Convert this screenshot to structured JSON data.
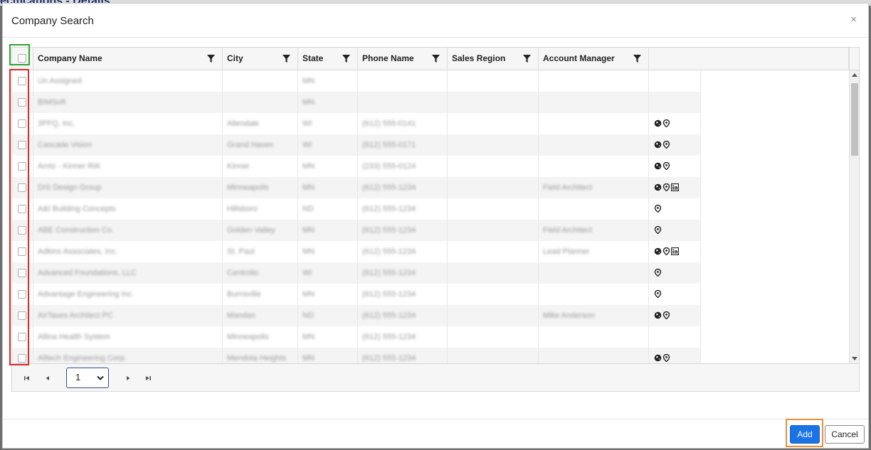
{
  "background": {
    "title": "ecifications - Details"
  },
  "modal": {
    "title": "Company Search",
    "close_symbol": "×"
  },
  "grid": {
    "columns": [
      "Company Name",
      "City",
      "State",
      "Phone Name",
      "Sales Region",
      "Account Manager"
    ],
    "rows": [
      {
        "company": "Un Assigned",
        "city": "",
        "state": "MN",
        "phone": "",
        "region": "",
        "manager": "",
        "icons": []
      },
      {
        "company": "BIMSoft",
        "city": "",
        "state": "MN",
        "phone": "",
        "region": "",
        "manager": "",
        "icons": []
      },
      {
        "company": "3PFQ, Inc.",
        "city": "Allendale",
        "state": "WI",
        "phone": "(612) 555-0141",
        "region": "",
        "manager": "",
        "icons": [
          "globe",
          "pin"
        ]
      },
      {
        "company": "Cascade Vision",
        "city": "Grand Haven",
        "state": "WI",
        "phone": "(612) 555-0171",
        "region": "",
        "manager": "",
        "icons": [
          "globe",
          "pin"
        ]
      },
      {
        "company": "Arntz - Kinner RIK",
        "city": "Kinner",
        "state": "MN",
        "phone": "(233) 555-0124",
        "region": "",
        "manager": "",
        "icons": [
          "globe",
          "pin"
        ]
      },
      {
        "company": "DIS Design Group",
        "city": "Minneapolis",
        "state": "MN",
        "phone": "(612) 555-1234",
        "region": "",
        "manager": "Field Architect",
        "icons": [
          "globe",
          "pin",
          "linkedin"
        ]
      },
      {
        "company": "A&I Building Concepts",
        "city": "Hillsboro",
        "state": "ND",
        "phone": "(612) 555-1234",
        "region": "",
        "manager": "",
        "icons": [
          "pin"
        ]
      },
      {
        "company": "ABE Construction Co.",
        "city": "Golden Valley",
        "state": "MN",
        "phone": "(612) 555-1234",
        "region": "",
        "manager": "Field Architect",
        "icons": [
          "pin"
        ]
      },
      {
        "company": "Adkins Associates, Inc.",
        "city": "St. Paul",
        "state": "MN",
        "phone": "(612) 555-1234",
        "region": "",
        "manager": "Lead Planner",
        "icons": [
          "globe",
          "pin",
          "linkedin"
        ]
      },
      {
        "company": "Advanced Foundations, LLC",
        "city": "Centrolio",
        "state": "WI",
        "phone": "(612) 555-1234",
        "region": "",
        "manager": "",
        "icons": [
          "pin"
        ]
      },
      {
        "company": "Advantage Engineering Inc.",
        "city": "Burnsville",
        "state": "MN",
        "phone": "(612) 555-1234",
        "region": "",
        "manager": "",
        "icons": [
          "pin"
        ]
      },
      {
        "company": "AirTaxes Architect PC",
        "city": "Mandan",
        "state": "ND",
        "phone": "(612) 555-1234",
        "region": "",
        "manager": "Mike Anderson",
        "icons": [
          "globe",
          "pin"
        ]
      },
      {
        "company": "Allina Health System",
        "city": "Minneapolis",
        "state": "MN",
        "phone": "(612) 555-1234",
        "region": "",
        "manager": "",
        "icons": []
      },
      {
        "company": "Alltech Engineering Corp.",
        "city": "Mendota Heights",
        "state": "MN",
        "phone": "(612) 555-1234",
        "region": "",
        "manager": "",
        "icons": [
          "globe",
          "pin"
        ]
      }
    ]
  },
  "pager": {
    "page": "1"
  },
  "footer": {
    "add_label": "Add",
    "cancel_label": "Cancel"
  },
  "colors": {
    "primary": "#1a73e8",
    "highlight_green": "#2fa32f",
    "highlight_red": "#d62b2b",
    "highlight_orange": "#e8903a"
  }
}
